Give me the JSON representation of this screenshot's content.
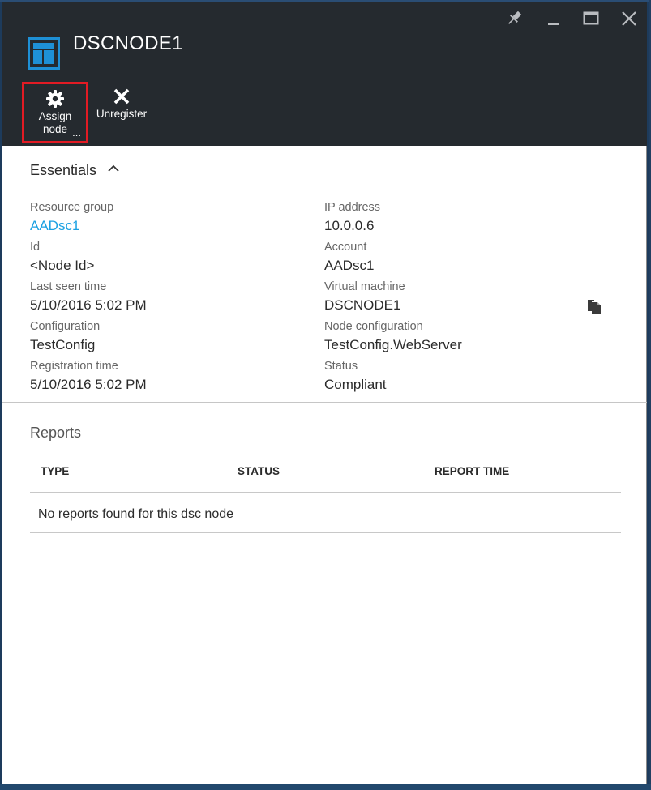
{
  "window": {
    "title": "DSCNODE1",
    "controls": [
      "pin-icon",
      "minimize-icon",
      "maximize-icon",
      "close-icon"
    ]
  },
  "commands": {
    "assign_line1": "Assign",
    "assign_line2": "node",
    "assign_more": "...",
    "unregister": "Unregister"
  },
  "essentials": {
    "title": "Essentials",
    "left": [
      {
        "label": "Resource group",
        "value": "AADsc1"
      },
      {
        "label": "Id",
        "value": "<Node Id>"
      },
      {
        "label": "Last seen time",
        "value": "5/10/2016 5:02 PM"
      },
      {
        "label": "Configuration",
        "value": "TestConfig"
      },
      {
        "label": "Registration time",
        "value": "5/10/2016 5:02 PM"
      }
    ],
    "right": [
      {
        "label": "IP address",
        "value": "10.0.0.6"
      },
      {
        "label": "Account",
        "value": "AADsc1"
      },
      {
        "label": "Virtual machine",
        "value": "DSCNODE1"
      },
      {
        "label": "Node configuration",
        "value": "TestConfig.WebServer"
      },
      {
        "label": "Status",
        "value": "Compliant"
      }
    ]
  },
  "reports": {
    "title": "Reports",
    "columns": [
      "TYPE",
      "STATUS",
      "REPORT TIME"
    ],
    "empty_message": "No reports found for this dsc node"
  },
  "colors": {
    "header_bg": "#252a2f",
    "accent_link": "#1ba1e2",
    "highlight_border": "#e21b24",
    "icon_blue": "#1e90d6"
  }
}
